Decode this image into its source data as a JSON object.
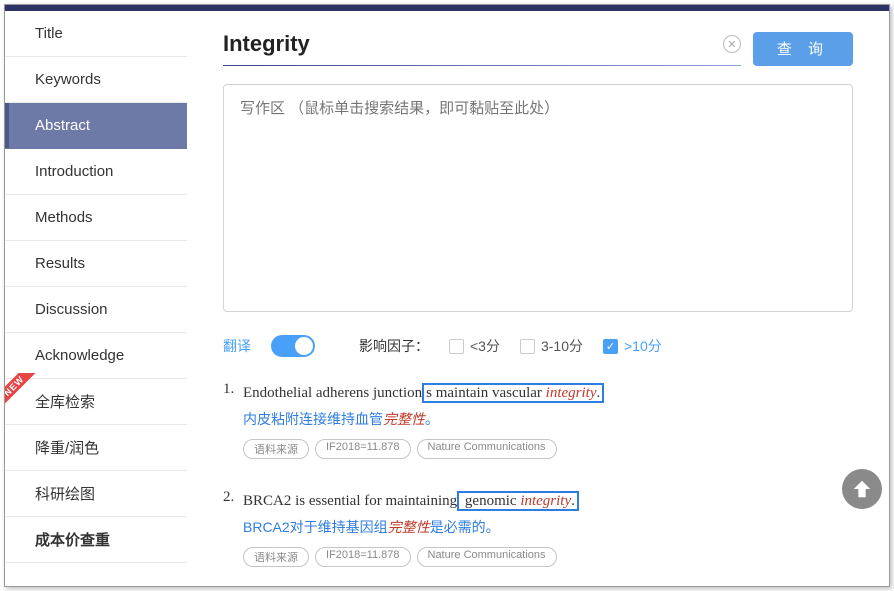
{
  "sidebar": {
    "items": [
      "Title",
      "Keywords",
      "Abstract",
      "Introduction",
      "Methods",
      "Results",
      "Discussion",
      "Acknowledge",
      "全库检索",
      "降重/润色",
      "科研绘图",
      "成本价查重"
    ],
    "new_badge": "NEW"
  },
  "search": {
    "value": "Integrity",
    "button": "查 询"
  },
  "writing": {
    "placeholder": "写作区 （鼠标单击搜索结果，即可黏贴至此处）"
  },
  "filters": {
    "translate_label": "翻译",
    "translate_on": true,
    "if_label": "影响因子：",
    "options": [
      {
        "label": "<3分",
        "checked": false
      },
      {
        "label": "3-10分",
        "checked": false
      },
      {
        "label": ">10分",
        "checked": true
      }
    ]
  },
  "results": [
    {
      "num": "1.",
      "en": {
        "pre": "Endothelial adherens junction",
        "boxed_pre": "s maintain vascular",
        "keyword": "integrity",
        "boxed_post": "."
      },
      "cn": {
        "pre": "内皮粘附连接维持血管",
        "keyword": "完整性",
        "post": "。"
      },
      "tags": [
        "语料来源",
        "IF2018=11.878",
        "Nature Communications"
      ]
    },
    {
      "num": "2.",
      "en": {
        "pre": "BRCA2 is essential for maintaining",
        "boxed_pre": " genomic",
        "keyword": "integrity",
        "boxed_post": "."
      },
      "cn": {
        "pre": "BRCA2对于维持基因组",
        "keyword": "完整性",
        "post": "是必需的。"
      },
      "tags": [
        "语料来源",
        "IF2018=11.878",
        "Nature Communications"
      ]
    }
  ]
}
